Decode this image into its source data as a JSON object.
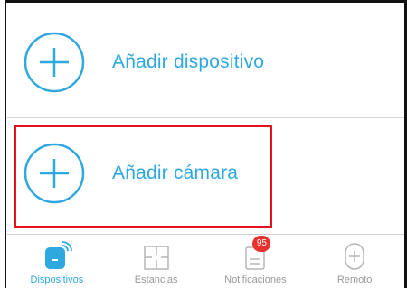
{
  "colors": {
    "accent": "#2fa8e0",
    "inactive": "#9a9a9a",
    "badge": "#e8322e",
    "highlight": "#e3121b"
  },
  "list": {
    "items": [
      {
        "label": "Añadir dispositivo",
        "icon": "plus-circle-icon"
      },
      {
        "label": "Añadir cámara",
        "icon": "plus-circle-icon"
      }
    ]
  },
  "tabbar": {
    "tabs": [
      {
        "label": "Dispositivos",
        "icon": "devices-icon",
        "active": true
      },
      {
        "label": "Estancias",
        "icon": "rooms-icon",
        "active": false
      },
      {
        "label": "Notificaciones",
        "icon": "notifications-icon",
        "active": false,
        "badge": "95"
      },
      {
        "label": "Remoto",
        "icon": "remote-icon",
        "active": false
      }
    ]
  }
}
